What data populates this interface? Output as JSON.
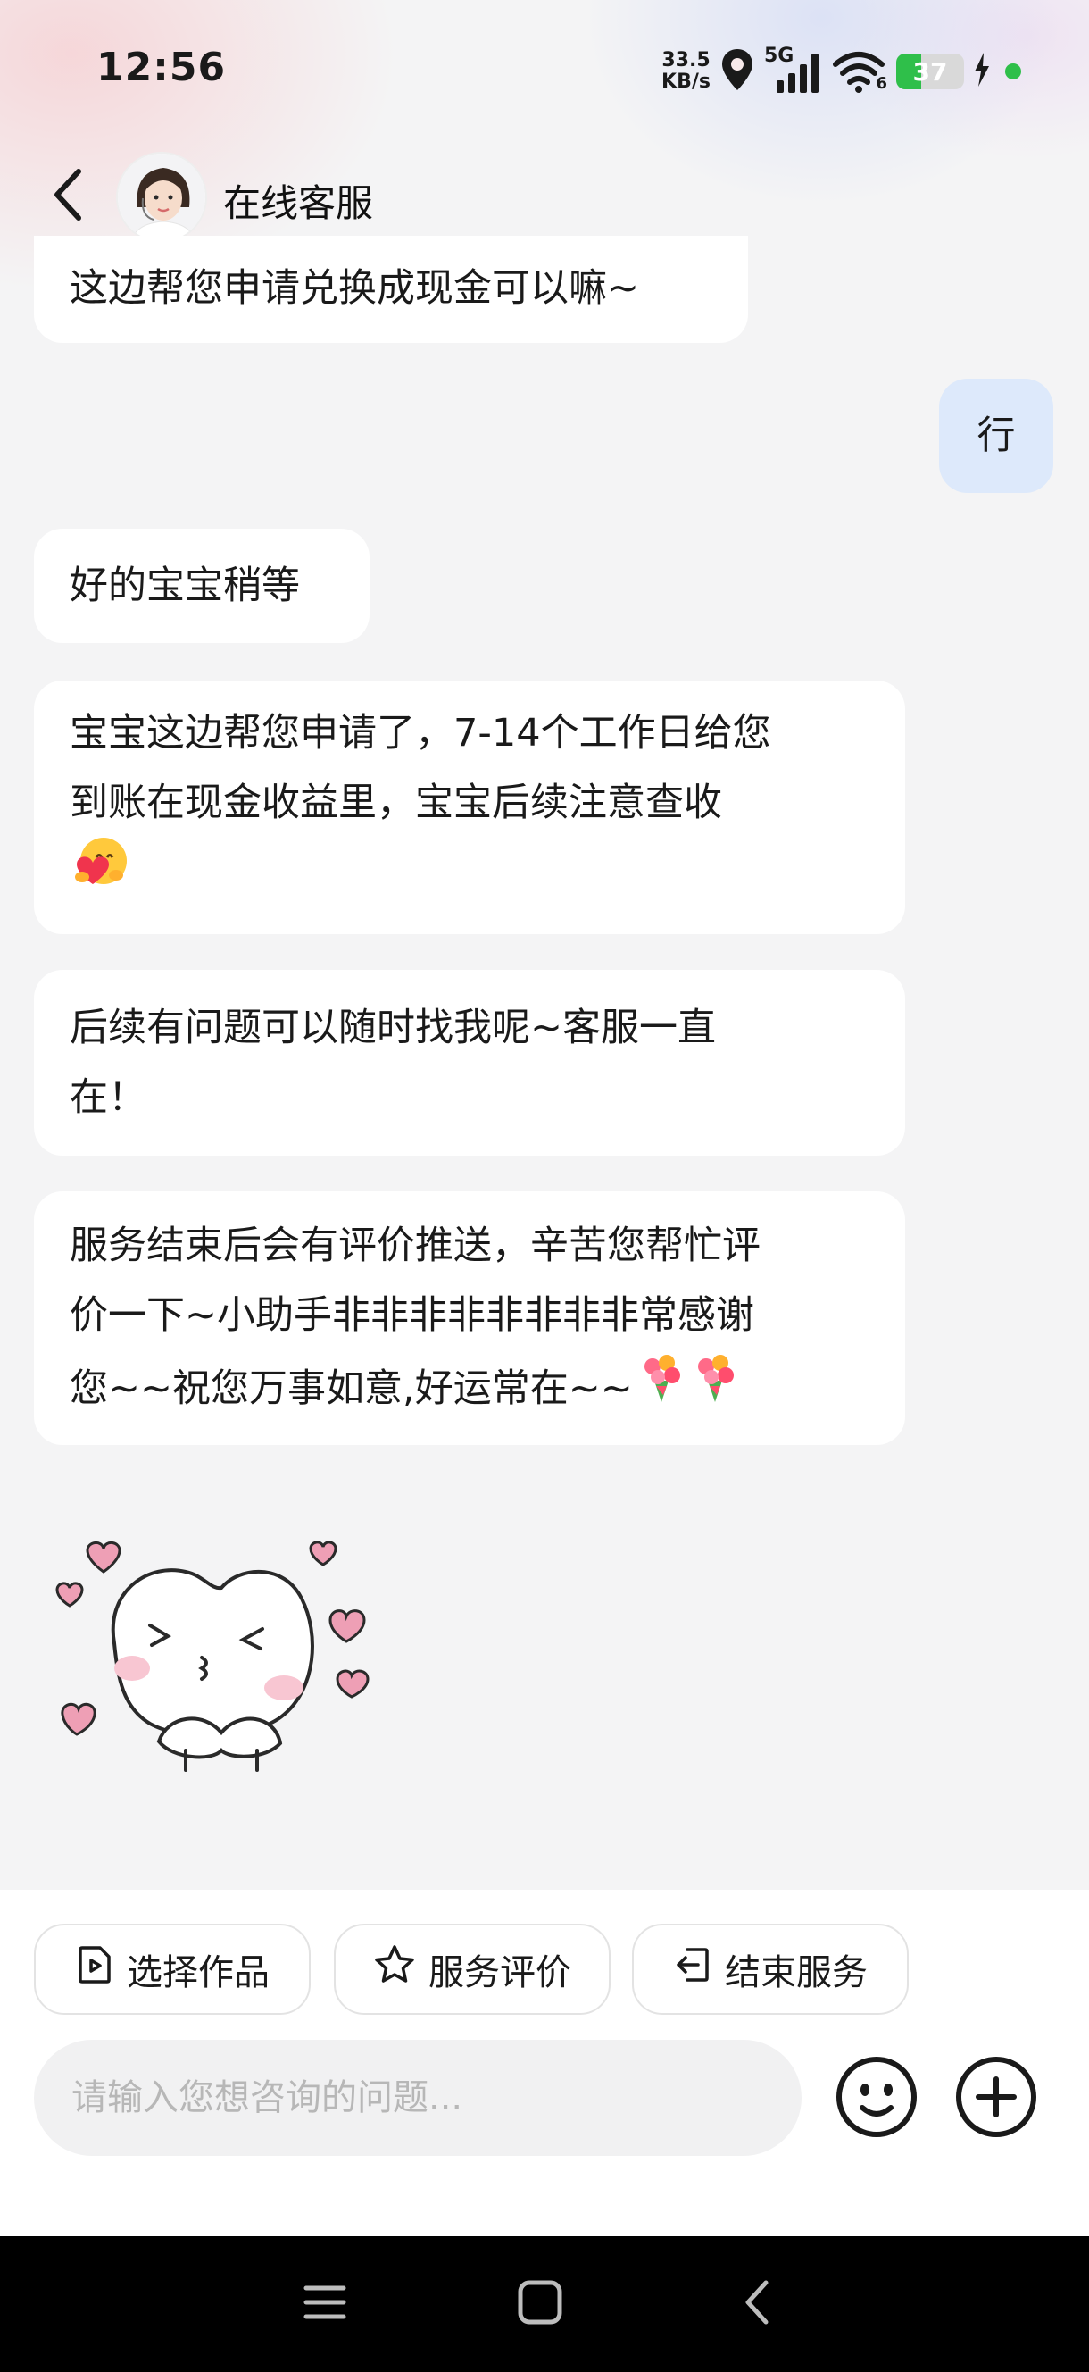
{
  "status_bar": {
    "time": "12:56",
    "net_speed_value": "33.5",
    "net_speed_unit": "KB/s",
    "network_type": "5G",
    "wifi_level": "6",
    "battery_level": "37",
    "battery_fraction": 0.37
  },
  "header": {
    "title": "在线客服",
    "avatar_icon": "agent-avatar"
  },
  "messages": [
    {
      "sender": "agent",
      "text": "这边帮您申请兑换成现金可以嘛~"
    },
    {
      "sender": "user",
      "text": "行"
    },
    {
      "sender": "agent",
      "text": "好的宝宝稍等"
    },
    {
      "sender": "agent",
      "text_lines": [
        "宝宝这边帮您申请了，7-14个工作日给您",
        "到账在现金收益里，宝宝后续注意查收"
      ],
      "emoji": "hugging-heart-emoji"
    },
    {
      "sender": "agent",
      "text_lines": [
        "后续有问题可以随时找我呢~客服一直",
        "在！"
      ]
    },
    {
      "sender": "agent",
      "text_lines": [
        "服务结束后会有评价推送，辛苦您帮忙评",
        "价一下~小助手非非非非非非非非常感谢",
        "您~~祝您万事如意,好运常在~~"
      ],
      "emoji": "bouquet-emoji"
    },
    {
      "sender": "agent",
      "sticker": "heart-bunny-sticker"
    }
  ],
  "actions": {
    "select_work": "选择作品",
    "rate_service": "服务评价",
    "end_service": "结束服务"
  },
  "input": {
    "placeholder": "请输入您想咨询的问题..."
  },
  "icons": {
    "emoji_button": "smiley-icon",
    "plus_button": "plus-circle-icon",
    "nav": [
      "menu-icon",
      "home-square-icon",
      "back-chevron-icon"
    ]
  },
  "colors": {
    "background": "#f4f4f5",
    "agent_bubble": "#ffffff",
    "user_bubble": "#dde9fb",
    "battery_green": "#2fbf4a",
    "nav_bar": "#000000"
  }
}
